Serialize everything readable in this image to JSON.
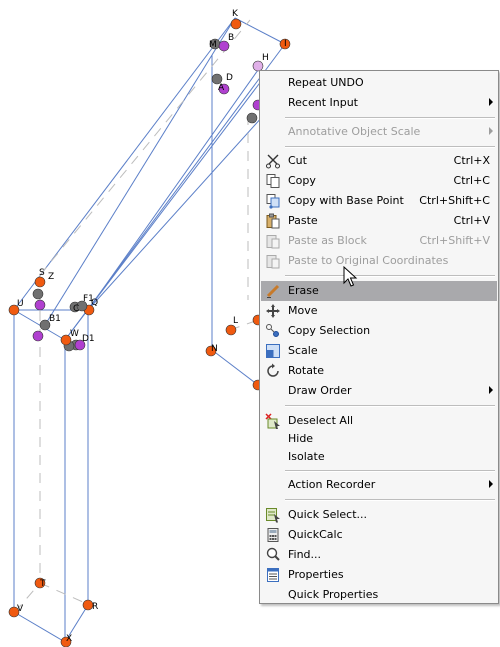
{
  "points": [
    {
      "name": "K",
      "label": "K",
      "color": "#f05a10"
    },
    {
      "name": "M",
      "label": "M",
      "color": "#707070"
    },
    {
      "name": "B",
      "label": "B",
      "color": "#b040d0"
    },
    {
      "name": "I",
      "label": "I",
      "color": "#f05a10"
    },
    {
      "name": "D",
      "label": "D",
      "color": "#707070"
    },
    {
      "name": "A",
      "label": "A",
      "color": "#b040d0"
    },
    {
      "name": "H",
      "label": "H",
      "color": "#e0b0e8"
    },
    {
      "name": "S",
      "label": "S",
      "color": "#f05a10"
    },
    {
      "name": "Z",
      "label": "Z",
      "color": "#707070"
    },
    {
      "name": "U",
      "label": "U",
      "color": "#f05a10"
    },
    {
      "name": "F1",
      "label": "F1",
      "color": "#f05a10"
    },
    {
      "name": "C",
      "label": "C",
      "color": "#707070"
    },
    {
      "name": "Q",
      "label": "Q",
      "color": "#707070"
    },
    {
      "name": "B1",
      "label": "B1",
      "color": "#707070"
    },
    {
      "name": "W",
      "label": "W",
      "color": "#707070"
    },
    {
      "name": "D1",
      "label": "D1",
      "color": "#707070"
    },
    {
      "name": "L",
      "label": "L",
      "color": "#f05a10"
    },
    {
      "name": "N",
      "label": "N",
      "color": "#f05a10"
    },
    {
      "name": "T",
      "label": "T",
      "color": "#f05a10"
    },
    {
      "name": "V",
      "label": "V",
      "color": "#f05a10"
    },
    {
      "name": "R",
      "label": "R",
      "color": "#f05a10"
    },
    {
      "name": "X",
      "label": "X",
      "color": "#f05a10"
    }
  ],
  "menu": {
    "items": [
      {
        "id": "repeat-undo",
        "label": "Repeat UNDO",
        "shortcut": "",
        "icon": "",
        "submenu": false,
        "disabled": false,
        "highlighted": false
      },
      {
        "id": "recent-input",
        "label": "Recent Input",
        "shortcut": "",
        "icon": "",
        "submenu": true,
        "disabled": false,
        "highlighted": false
      },
      {
        "id": "annotative-object-scale",
        "label": "Annotative Object Scale",
        "shortcut": "",
        "icon": "",
        "submenu": true,
        "disabled": true,
        "highlighted": false
      },
      {
        "id": "cut",
        "label": "Cut",
        "shortcut": "Ctrl+X",
        "icon": "scissors-icon",
        "submenu": false,
        "disabled": false,
        "highlighted": false
      },
      {
        "id": "copy",
        "label": "Copy",
        "shortcut": "Ctrl+C",
        "icon": "copy-icon",
        "submenu": false,
        "disabled": false,
        "highlighted": false
      },
      {
        "id": "copy-with-base-point",
        "label": "Copy with Base Point",
        "shortcut": "Ctrl+Shift+C",
        "icon": "copy-base-point-icon",
        "submenu": false,
        "disabled": false,
        "highlighted": false
      },
      {
        "id": "paste",
        "label": "Paste",
        "shortcut": "Ctrl+V",
        "icon": "paste-icon",
        "submenu": false,
        "disabled": false,
        "highlighted": false
      },
      {
        "id": "paste-as-block",
        "label": "Paste as Block",
        "shortcut": "Ctrl+Shift+V",
        "icon": "paste-block-icon",
        "submenu": false,
        "disabled": true,
        "highlighted": false
      },
      {
        "id": "paste-to-original-coordinates",
        "label": "Paste to Original Coordinates",
        "shortcut": "",
        "icon": "paste-coords-icon",
        "submenu": false,
        "disabled": true,
        "highlighted": false
      },
      {
        "id": "erase",
        "label": "Erase",
        "shortcut": "",
        "icon": "eraser-icon",
        "submenu": false,
        "disabled": false,
        "highlighted": true
      },
      {
        "id": "move",
        "label": "Move",
        "shortcut": "",
        "icon": "move-icon",
        "submenu": false,
        "disabled": false,
        "highlighted": false
      },
      {
        "id": "copy-selection",
        "label": "Copy Selection",
        "shortcut": "",
        "icon": "copy-selection-icon",
        "submenu": false,
        "disabled": false,
        "highlighted": false
      },
      {
        "id": "scale",
        "label": "Scale",
        "shortcut": "",
        "icon": "scale-icon",
        "submenu": false,
        "disabled": false,
        "highlighted": false
      },
      {
        "id": "rotate",
        "label": "Rotate",
        "shortcut": "",
        "icon": "rotate-icon",
        "submenu": false,
        "disabled": false,
        "highlighted": false
      },
      {
        "id": "draw-order",
        "label": "Draw Order",
        "shortcut": "",
        "icon": "",
        "submenu": true,
        "disabled": false,
        "highlighted": false
      },
      {
        "id": "deselect-all",
        "label": "Deselect All",
        "shortcut": "",
        "icon": "deselect-icon",
        "submenu": false,
        "disabled": false,
        "highlighted": false
      },
      {
        "id": "hide",
        "label": "Hide",
        "shortcut": "",
        "icon": "",
        "submenu": false,
        "disabled": false,
        "highlighted": false
      },
      {
        "id": "isolate",
        "label": "Isolate",
        "shortcut": "",
        "icon": "",
        "submenu": false,
        "disabled": false,
        "highlighted": false
      },
      {
        "id": "action-recorder",
        "label": "Action Recorder",
        "shortcut": "",
        "icon": "",
        "submenu": true,
        "disabled": false,
        "highlighted": false
      },
      {
        "id": "quick-select",
        "label": "Quick Select...",
        "shortcut": "",
        "icon": "quick-select-icon",
        "submenu": false,
        "disabled": false,
        "highlighted": false
      },
      {
        "id": "quickcalc",
        "label": "QuickCalc",
        "shortcut": "",
        "icon": "calculator-icon",
        "submenu": false,
        "disabled": false,
        "highlighted": false
      },
      {
        "id": "find",
        "label": "Find...",
        "shortcut": "",
        "icon": "find-icon",
        "submenu": false,
        "disabled": false,
        "highlighted": false
      },
      {
        "id": "properties",
        "label": "Properties",
        "shortcut": "",
        "icon": "properties-icon",
        "submenu": false,
        "disabled": false,
        "highlighted": false
      },
      {
        "id": "quick-properties",
        "label": "Quick Properties",
        "shortcut": "",
        "icon": "",
        "submenu": false,
        "disabled": false,
        "highlighted": false
      }
    ]
  }
}
